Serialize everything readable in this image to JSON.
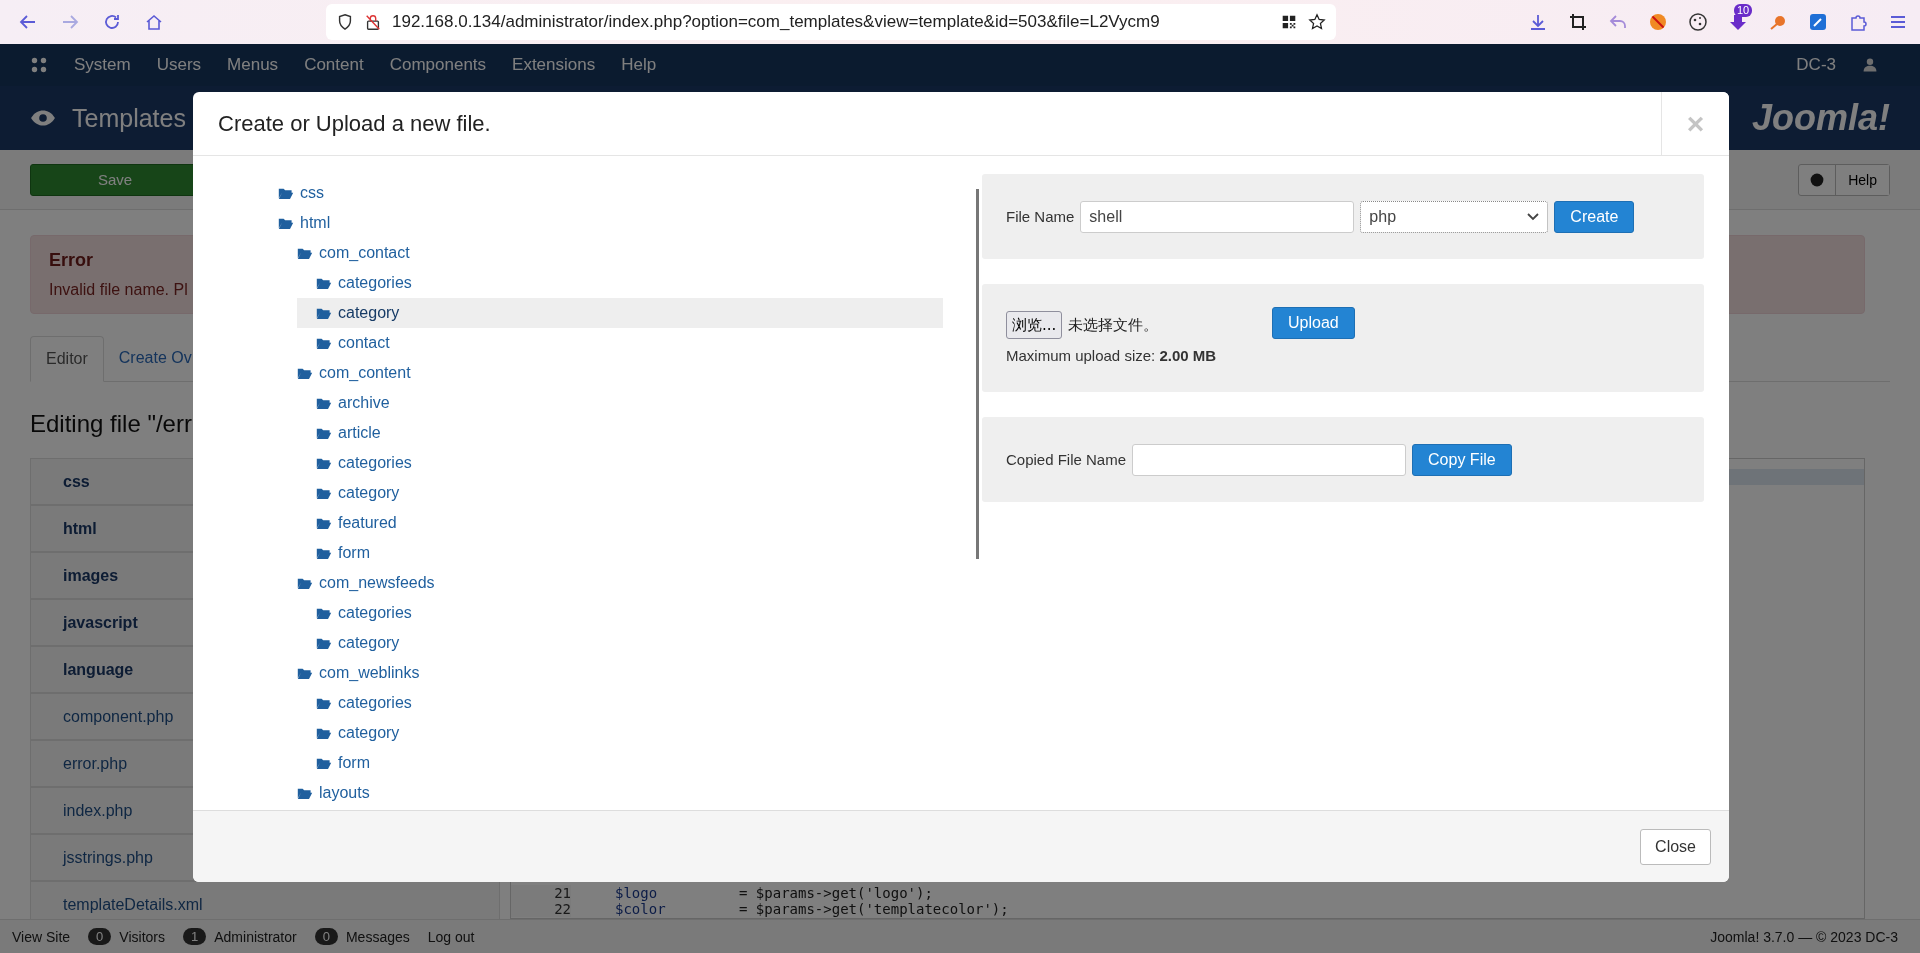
{
  "browser": {
    "url": "192.168.0.134/administrator/index.php?option=com_templates&view=template&id=503&file=L2Vycm9",
    "badge": "10"
  },
  "nav": {
    "items": [
      "System",
      "Users",
      "Menus",
      "Content",
      "Components",
      "Extensions",
      "Help"
    ],
    "user": "DC-3"
  },
  "header": {
    "title": "Templates",
    "logo": "Joomla!"
  },
  "toolbar": {
    "save": "Save",
    "help": "Help"
  },
  "alert": {
    "title": "Error",
    "message": "Invalid file name. Pl"
  },
  "tabs": [
    {
      "label": "Editor",
      "selected": true
    },
    {
      "label": "Create Ov",
      "selected": false
    }
  ],
  "editing_title": "Editing file \"/err",
  "files": [
    {
      "name": "css",
      "kind": "folder"
    },
    {
      "name": "html",
      "kind": "folder"
    },
    {
      "name": "images",
      "kind": "folder"
    },
    {
      "name": "javascript",
      "kind": "folder"
    },
    {
      "name": "language",
      "kind": "folder"
    },
    {
      "name": "component.php",
      "kind": "file"
    },
    {
      "name": "error.php",
      "kind": "file"
    },
    {
      "name": "index.php",
      "kind": "file"
    },
    {
      "name": "jsstrings.php",
      "kind": "file"
    },
    {
      "name": "templateDetails.xml",
      "kind": "file"
    }
  ],
  "code": [
    {
      "number": "21",
      "variable": "$logo",
      "code": "= $params->get('logo');"
    },
    {
      "number": "22",
      "variable": "$color",
      "code": "= $params->get('templatecolor');"
    }
  ],
  "status": {
    "view_site": "View Site",
    "counters": [
      {
        "count": "0",
        "label": "Visitors"
      },
      {
        "count": "1",
        "label": "Administrator"
      },
      {
        "count": "0",
        "label": "Messages"
      }
    ],
    "logout": "Log out",
    "version": "Joomla! 3.7.0  —  © 2023 DC-3"
  },
  "modal": {
    "title": "Create or Upload a new file.",
    "close": "×",
    "tree": [
      {
        "name": "css",
        "selected": false
      },
      {
        "name": "html",
        "selected": false,
        "children": [
          {
            "name": "com_contact",
            "selected": false,
            "children": [
              {
                "name": "categories",
                "selected": false
              },
              {
                "name": "category",
                "selected": true
              },
              {
                "name": "contact",
                "selected": false
              }
            ]
          },
          {
            "name": "com_content",
            "selected": false,
            "children": [
              {
                "name": "archive",
                "selected": false
              },
              {
                "name": "article",
                "selected": false
              },
              {
                "name": "categories",
                "selected": false
              },
              {
                "name": "category",
                "selected": false
              },
              {
                "name": "featured",
                "selected": false
              },
              {
                "name": "form",
                "selected": false
              }
            ]
          },
          {
            "name": "com_newsfeeds",
            "selected": false,
            "children": [
              {
                "name": "categories",
                "selected": false
              },
              {
                "name": "category",
                "selected": false
              }
            ]
          },
          {
            "name": "com_weblinks",
            "selected": false,
            "children": [
              {
                "name": "categories",
                "selected": false
              },
              {
                "name": "category",
                "selected": false
              },
              {
                "name": "form",
                "selected": false
              }
            ]
          },
          {
            "name": "layouts",
            "selected": false
          }
        ]
      }
    ],
    "create": {
      "label": "File Name",
      "value": "shell",
      "type": "php",
      "button": "Create"
    },
    "upload": {
      "browse": "浏览...",
      "no_file": "未选择文件。",
      "button": "Upload",
      "max": "Maximum upload size: **2.00 MB**"
    },
    "copy": {
      "label": "Copied File Name",
      "button": "Copy File"
    },
    "footer_button": "Close"
  }
}
